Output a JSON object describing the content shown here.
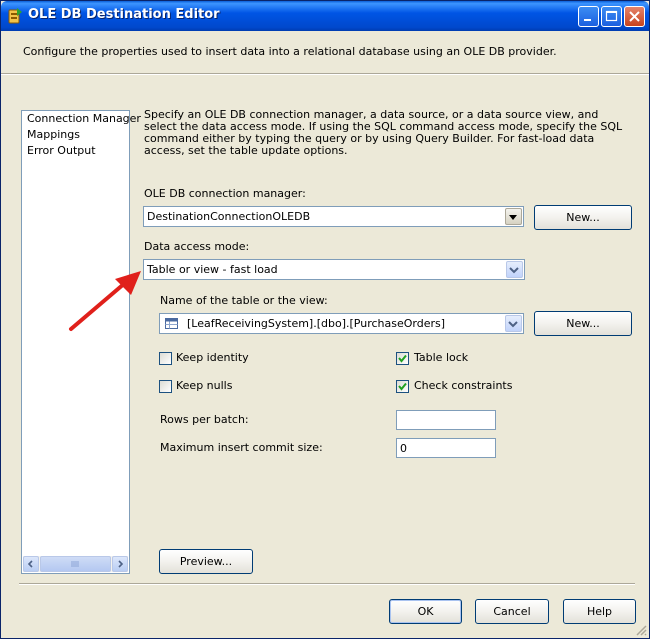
{
  "window": {
    "title": "OLE DB Destination Editor",
    "description": "Configure the properties used to insert data into a relational database using an OLE DB provider."
  },
  "nav": {
    "items": [
      {
        "label": "Connection Manager"
      },
      {
        "label": "Mappings"
      },
      {
        "label": "Error Output"
      }
    ]
  },
  "main": {
    "instructions": "Specify an OLE DB connection manager, a data source, or a data source view, and select the data access mode. If using the SQL command access mode, specify the SQL command either by typing the query or by using Query Builder. For fast-load data access, set the table update options.",
    "connection_label": "OLE DB connection manager:",
    "connection_value": "DestinationConnectionOLEDB",
    "new_label": "New...",
    "access_mode_label": "Data access mode:",
    "access_mode_value": "Table or view - fast load",
    "table_label": "Name of the table or the view:",
    "table_value": "[LeafReceivingSystem].[dbo].[PurchaseOrders]",
    "table_new_label": "New...",
    "keep_identity": {
      "label": "Keep identity",
      "checked": false
    },
    "keep_nulls": {
      "label": "Keep nulls",
      "checked": false
    },
    "table_lock": {
      "label": "Table lock",
      "checked": true
    },
    "check_constraints": {
      "label": "Check constraints",
      "checked": true
    },
    "rows_per_batch_label": "Rows per batch:",
    "rows_per_batch_value": "",
    "max_commit_label": "Maximum insert commit size:",
    "max_commit_value": "0",
    "preview_label": "Preview..."
  },
  "footer": {
    "ok_label": "OK",
    "cancel_label": "Cancel",
    "help_label": "Help"
  },
  "colors": {
    "titlebar": "#0055e5",
    "annotation_arrow": "#e0201b",
    "checkmark": "#21a121"
  },
  "icons": [
    "ssis-destination-icon",
    "minimize-icon",
    "maximize-icon",
    "close-icon",
    "chevron-down-icon",
    "table-icon",
    "checkmark-icon",
    "scroll-left-icon",
    "scroll-right-icon",
    "resize-grip-icon"
  ]
}
